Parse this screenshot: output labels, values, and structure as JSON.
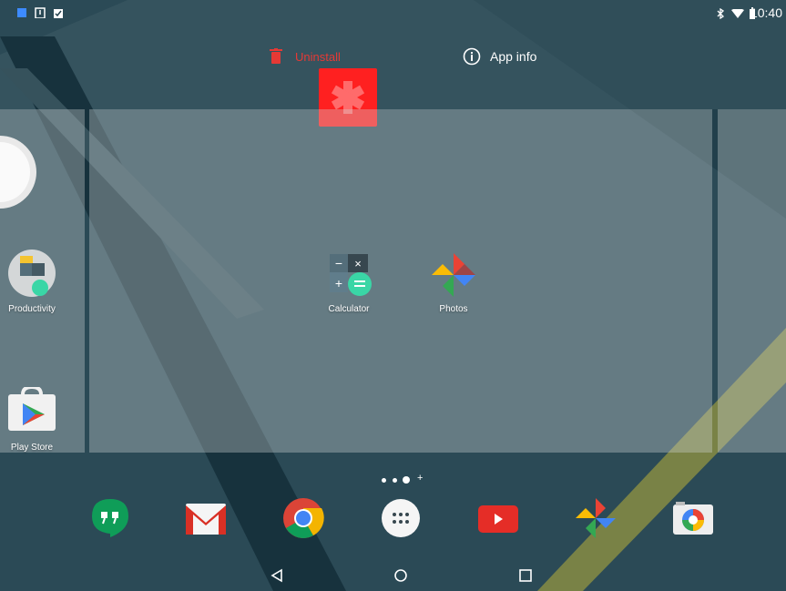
{
  "status_bar": {
    "time": "10:40",
    "left_icons": [
      "screenshot-icon",
      "download-icon",
      "clipboard-check-icon"
    ],
    "right_icons": [
      "bluetooth-icon",
      "wifi-icon",
      "battery-icon"
    ]
  },
  "drop_targets": {
    "uninstall_label": "Uninstall",
    "app_info_label": "App info"
  },
  "dragged_item": {
    "color": "#ff2020",
    "icon": "asterisk-icon"
  },
  "left_panel": {
    "apps": [
      {
        "label": "Productivity",
        "icon": "folder-icon"
      },
      {
        "label": "Play Store",
        "icon": "play-store-icon"
      }
    ]
  },
  "center_panel": {
    "apps": [
      {
        "label": "Calculator",
        "icon": "calculator-icon"
      },
      {
        "label": "Photos",
        "icon": "photos-icon"
      }
    ]
  },
  "page_indicator": {
    "pages": 3,
    "current": 3,
    "add_page_symbol": "+"
  },
  "dock": {
    "apps": [
      "hangouts-icon",
      "gmail-icon",
      "chrome-icon",
      "app-drawer-icon",
      "youtube-icon",
      "photos-icon",
      "camera-icon"
    ]
  },
  "nav_bar": {
    "buttons": [
      "back-icon",
      "home-icon",
      "recents-icon"
    ]
  },
  "colors": {
    "accent_red": "#e53935",
    "wallpaper": "#213f4b"
  }
}
